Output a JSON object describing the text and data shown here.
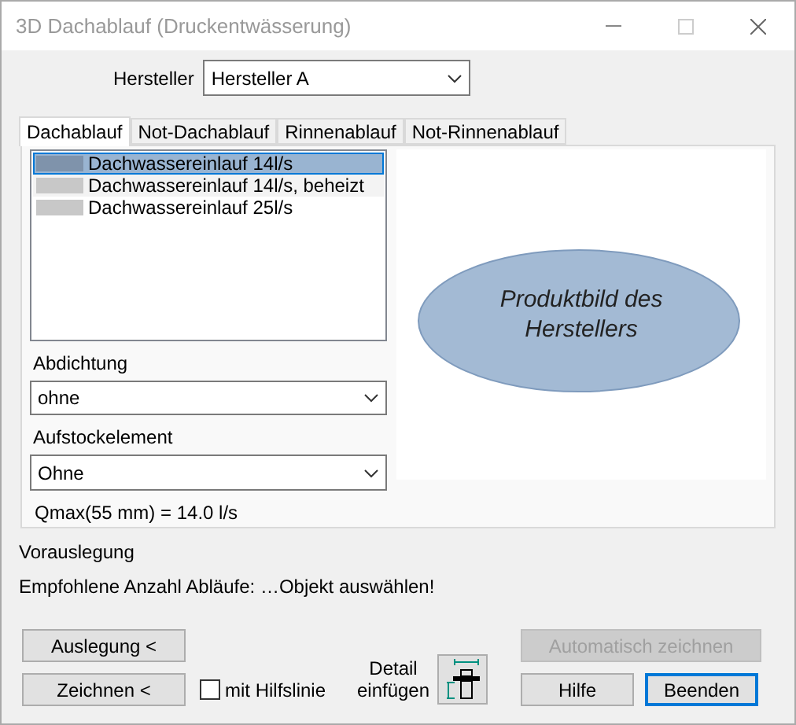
{
  "window": {
    "title": "3D Dachablauf (Druckentwässerung)",
    "maximize_disabled": true
  },
  "manufacturer": {
    "label": "Hersteller",
    "value": "Hersteller A"
  },
  "tabs": [
    {
      "label": "Dachablauf",
      "selected": true
    },
    {
      "label": "Not-Dachablauf",
      "selected": false
    },
    {
      "label": "Rinnenablauf",
      "selected": false
    },
    {
      "label": "Not-Rinnenablauf",
      "selected": false
    }
  ],
  "products": [
    {
      "name": "Dachwassereinlauf 14l/s",
      "selected": true
    },
    {
      "name": "Dachwassereinlauf 14l/s, beheizt",
      "selected": false
    },
    {
      "name": "Dachwassereinlauf 25l/s",
      "selected": false
    }
  ],
  "image_placeholder": "Produktbild des Herstellers",
  "sealing": {
    "label": "Abdichtung",
    "value": "ohne"
  },
  "extension": {
    "label": "Aufstockelement",
    "value": "Ohne"
  },
  "qmax": "Qmax(55 mm) = 14.0 l/s",
  "preliminary": {
    "title": "Vorauslegung",
    "text": "Empfohlene Anzahl Abläufe: …Objekt auswählen!"
  },
  "buttons": [
    {
      "label": "Auslegung <",
      "disabled": false,
      "focused": false
    },
    {
      "label": "Zeichnen <",
      "disabled": false,
      "focused": false
    },
    {
      "label": "Automatisch zeichnen",
      "disabled": true,
      "focused": false
    },
    {
      "label": "Hilfe",
      "disabled": false,
      "focused": false
    },
    {
      "label": "Beenden",
      "disabled": false,
      "focused": true
    }
  ],
  "helper_line": {
    "label": "mit Hilfslinie",
    "checked": false
  },
  "detail": {
    "label": "Detail einfügen"
  }
}
